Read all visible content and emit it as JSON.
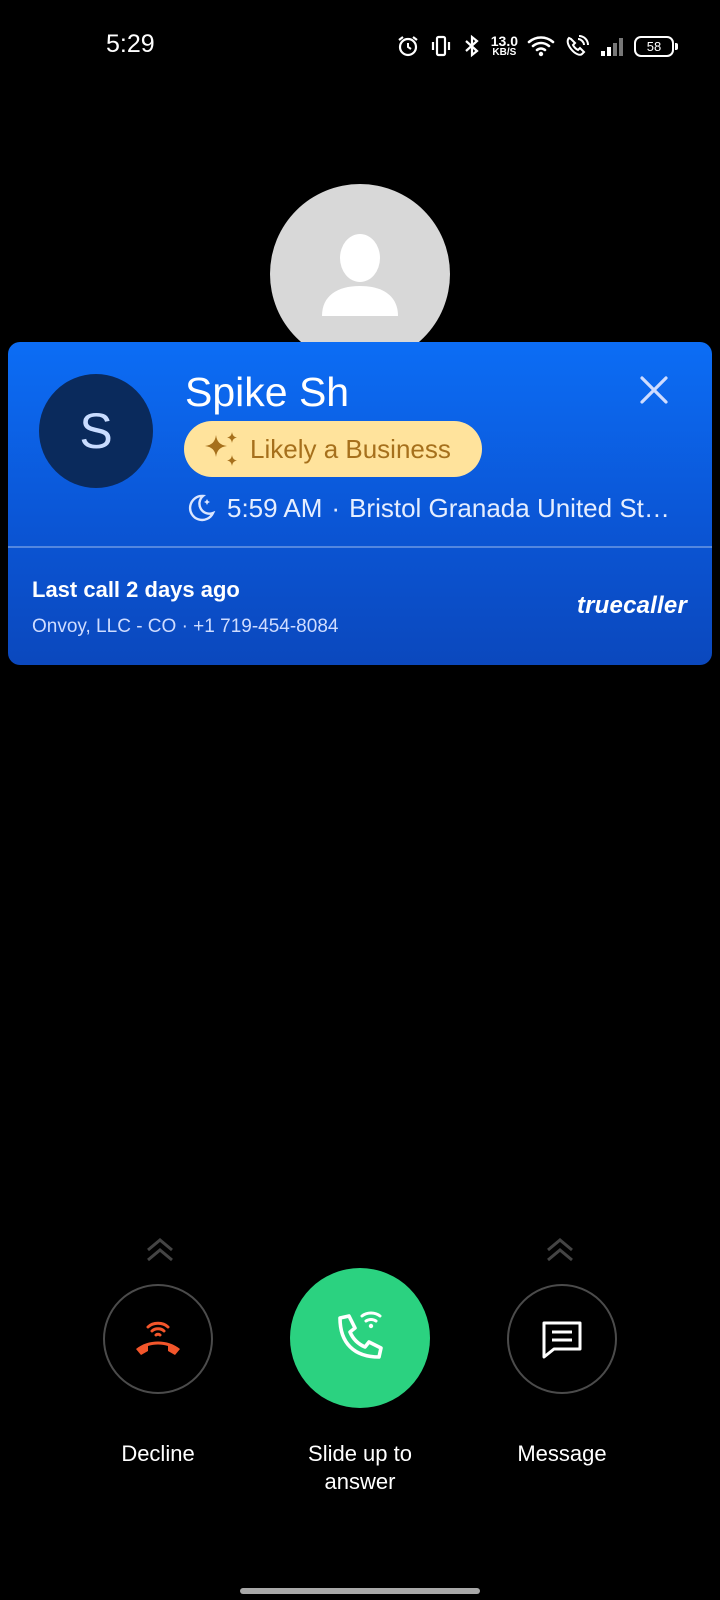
{
  "status_bar": {
    "time": "5:29",
    "net_speed_value": "13.0",
    "net_speed_unit": "KB/S",
    "battery": "58",
    "icons": [
      "alarm-icon",
      "vibrate-icon",
      "bluetooth-icon",
      "wifi-icon",
      "wifi-calling-icon",
      "signal-icon",
      "battery-icon"
    ]
  },
  "caller": {
    "avatar_icon": "person-icon"
  },
  "truecaller_card": {
    "avatar_initial": "S",
    "name": "Spike Sh",
    "badge_label": "Likely a Business",
    "badge_icon": "sparkle-icon",
    "time_icon": "moon-icon",
    "local_time": "5:59 AM",
    "separator": "·",
    "location": "Bristol Granada United St…",
    "last_call": "Last call 2 days ago",
    "carrier_info": "Onvoy, LLC - CO · +1 719-454-8084",
    "brand": "truecaller",
    "colors": {
      "card": "#0b5ee3",
      "badge_bg": "#ffe39c",
      "badge_text": "#a6701c",
      "avatar_bg": "#0a2a5c"
    }
  },
  "controls": {
    "decline_label": "Decline",
    "answer_label": "Slide up to answer",
    "message_label": "Message",
    "colors": {
      "decline_icon": "#f3562b",
      "answer_bg": "#2bd280"
    }
  }
}
